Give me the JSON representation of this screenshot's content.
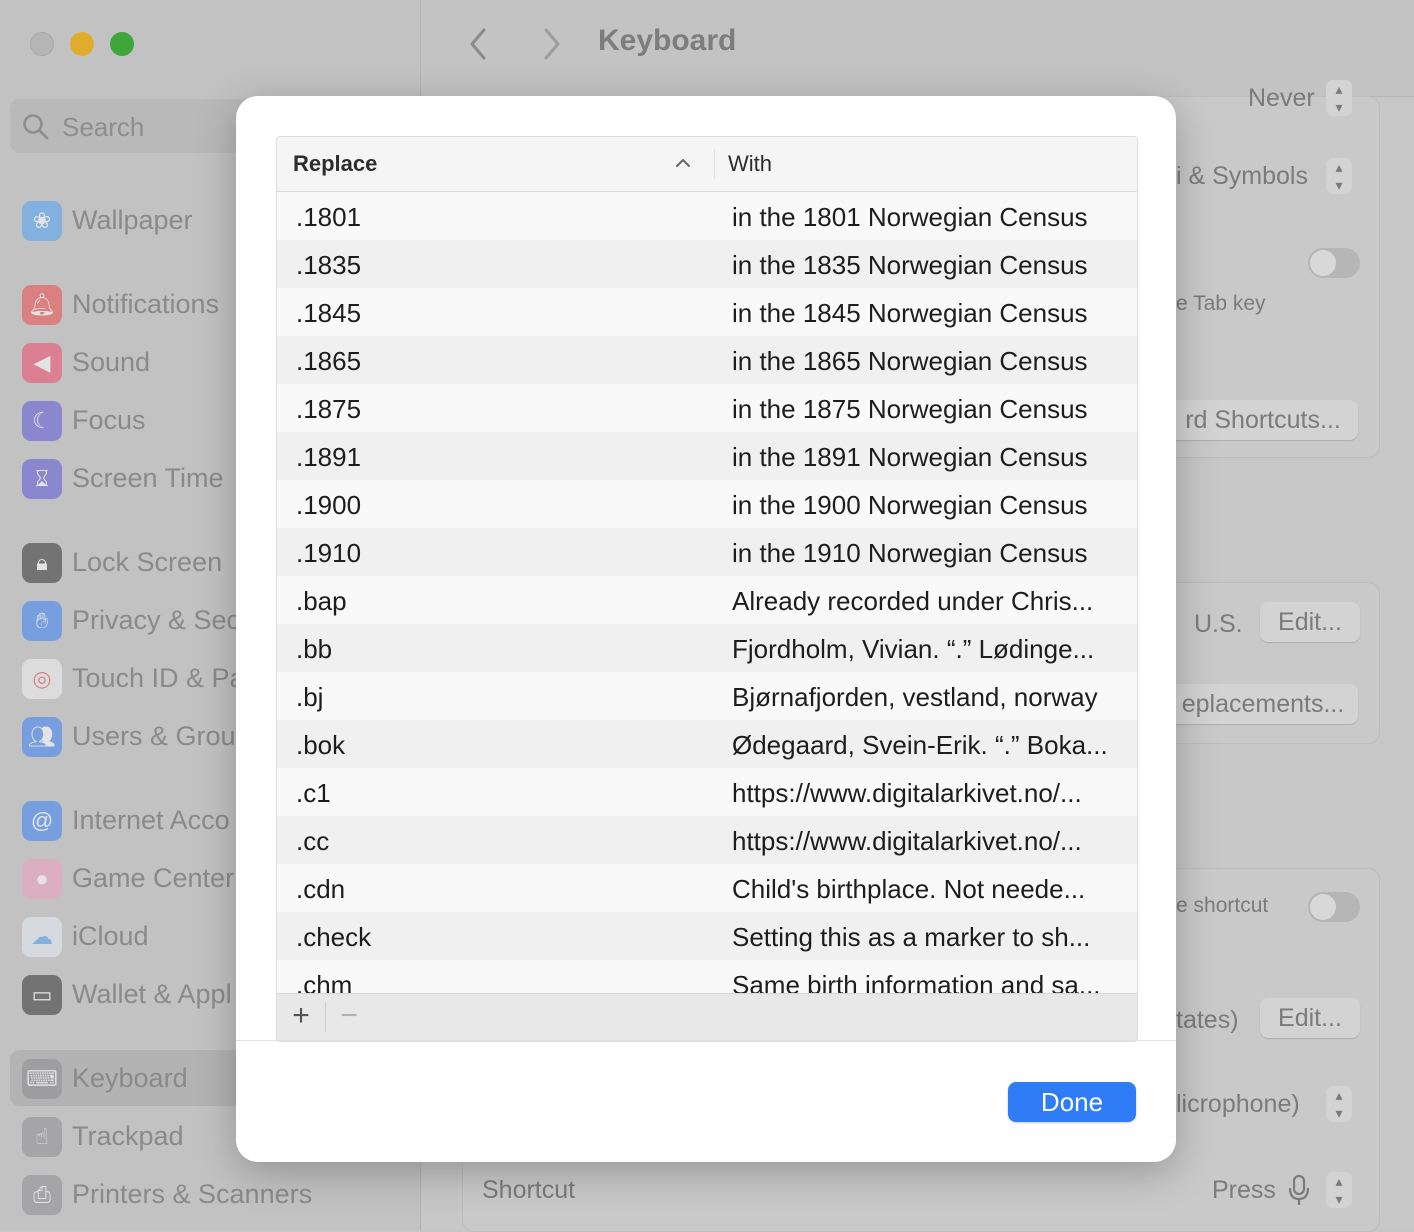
{
  "window": {
    "title": "Keyboard"
  },
  "sidebar": {
    "search_placeholder": "Search",
    "items": [
      {
        "label": "Wallpaper",
        "icon": "wallpaper-icon",
        "color": "#4fa3f7"
      },
      {
        "label": "Notifications",
        "icon": "notifications-icon",
        "color": "#ef4b4b"
      },
      {
        "label": "Sound",
        "icon": "sound-icon",
        "color": "#ef4b6b"
      },
      {
        "label": "Focus",
        "icon": "focus-icon",
        "color": "#5b57d6"
      },
      {
        "label": "Screen Time",
        "icon": "screen-time-icon",
        "color": "#5b57d6"
      },
      {
        "label": "Lock Screen",
        "icon": "lock-icon",
        "color": "#333333"
      },
      {
        "label": "Privacy & Sec",
        "icon": "privacy-hand-icon",
        "color": "#3b82f6"
      },
      {
        "label": "Touch ID & Pa",
        "icon": "fingerprint-icon",
        "color": "#f2f2f2"
      },
      {
        "label": "Users & Grou",
        "icon": "users-icon",
        "color": "#3b82f6"
      },
      {
        "label": "Internet Acco",
        "icon": "at-sign-icon",
        "color": "#3b82f6"
      },
      {
        "label": "Game Center",
        "icon": "game-center-icon",
        "color": "#f0a0c0"
      },
      {
        "label": "iCloud",
        "icon": "icloud-icon",
        "color": "#e8eef7"
      },
      {
        "label": "Wallet & Appl",
        "icon": "wallet-icon",
        "color": "#333333"
      },
      {
        "label": "Keyboard",
        "icon": "keyboard-icon",
        "color": "#8e8e93"
      },
      {
        "label": "Trackpad",
        "icon": "trackpad-icon",
        "color": "#8e8e93"
      },
      {
        "label": "Printers & Scanners",
        "icon": "printer-icon",
        "color": "#8e8e93"
      }
    ]
  },
  "background": {
    "never_label": "Never",
    "emoji_symbols": "i & Symbols",
    "tab_key": "e Tab key",
    "shortcuts_btn": "rd Shortcuts...",
    "us_label": "U.S.",
    "edit_btn": "Edit...",
    "replacements_btn": "eplacements...",
    "shortcut_toggle_label": "e shortcut",
    "states_label": "tates)",
    "edit_btn2": "Edit...",
    "microphone_label": "licrophone)",
    "shortcut_label": "Shortcut",
    "press_label": "Press"
  },
  "dialog": {
    "columns": {
      "replace": "Replace",
      "with": "With"
    },
    "rows": [
      {
        "replace": ".1801",
        "with": "in the 1801 Norwegian Census"
      },
      {
        "replace": ".1835",
        "with": "in the 1835 Norwegian Census"
      },
      {
        "replace": ".1845",
        "with": "in the 1845 Norwegian Census"
      },
      {
        "replace": ".1865",
        "with": "in the 1865 Norwegian Census"
      },
      {
        "replace": ".1875",
        "with": "in the 1875 Norwegian Census"
      },
      {
        "replace": ".1891",
        "with": "in the 1891 Norwegian Census"
      },
      {
        "replace": ".1900",
        "with": "in the 1900 Norwegian Census"
      },
      {
        "replace": ".1910",
        "with": "in the 1910 Norwegian Census"
      },
      {
        "replace": ".bap",
        "with": "Already recorded under Chris..."
      },
      {
        "replace": ".bb",
        "with": "Fjordholm, Vivian. “.” Lødinge..."
      },
      {
        "replace": ".bj",
        "with": "Bjørnafjorden, vestland, norway"
      },
      {
        "replace": ".bok",
        "with": "Ødegaard, Svein-Erik. “.” Boka..."
      },
      {
        "replace": ".c1",
        "with": "https://www.digitalarkivet.no/..."
      },
      {
        "replace": ".cc",
        "with": "https://www.digitalarkivet.no/..."
      },
      {
        "replace": ".cdn",
        "with": "Child's birthplace. Not neede..."
      },
      {
        "replace": ".check",
        "with": "Setting this as a marker to sh..."
      },
      {
        "replace": ".chm",
        "with": "Same birth information and sa..."
      }
    ],
    "add_label": "+",
    "remove_label": "−",
    "done_label": "Done"
  },
  "colors": {
    "accent": "#2f7cf6"
  }
}
